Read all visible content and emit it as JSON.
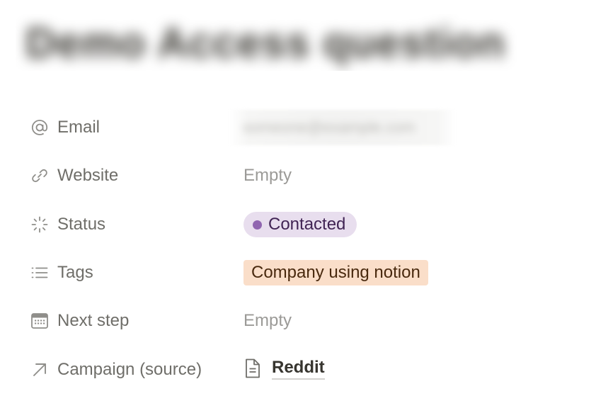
{
  "page": {
    "title": "Demo Access question"
  },
  "properties": {
    "email": {
      "label": "Email",
      "icon": "at-sign-icon",
      "value": "someone@example.com"
    },
    "website": {
      "label": "Website",
      "icon": "link-icon",
      "value": "Empty"
    },
    "status": {
      "label": "Status",
      "icon": "status-spinner-icon",
      "value": "Contacted",
      "color": "#9065b0",
      "bg": "#e8deee"
    },
    "tags": {
      "label": "Tags",
      "icon": "list-icon",
      "value": "Company using notion",
      "bg": "#fadec9"
    },
    "next_step": {
      "label": "Next step",
      "icon": "calendar-icon",
      "value": "Empty"
    },
    "campaign": {
      "label": "Campaign (source)",
      "icon": "arrow-up-right-icon",
      "value": "Reddit",
      "value_icon": "document-icon"
    }
  }
}
